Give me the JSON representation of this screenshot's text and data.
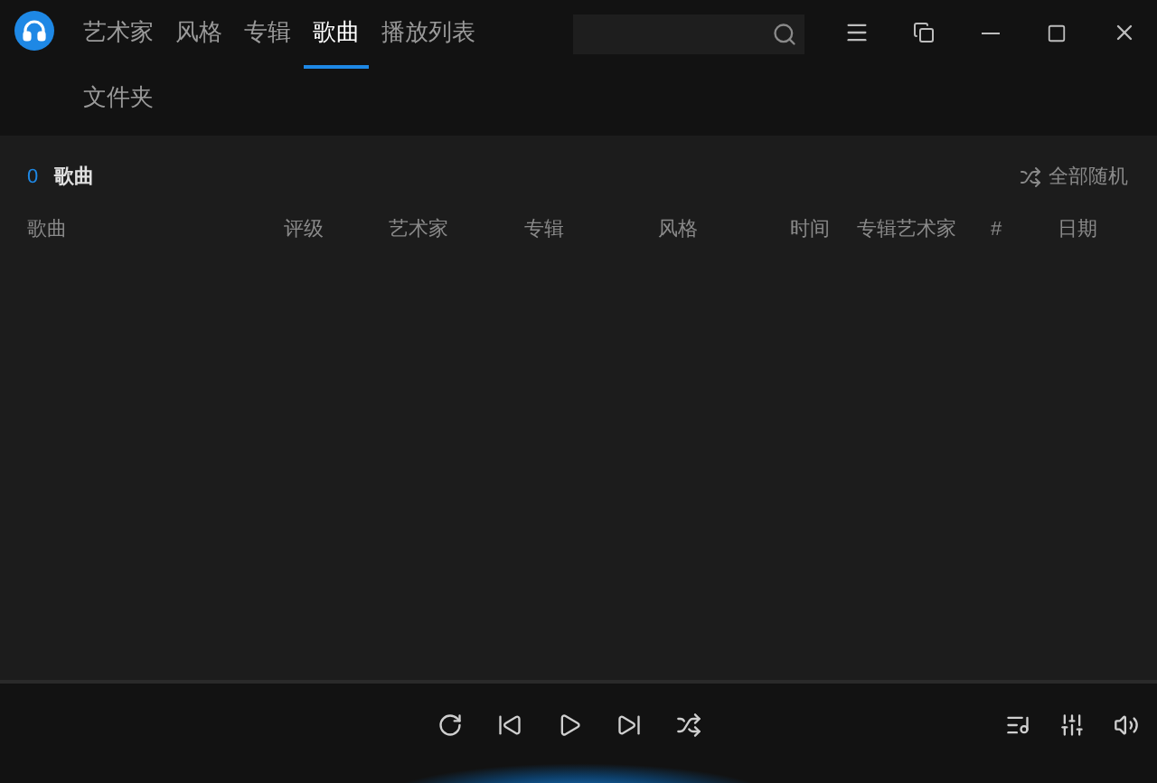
{
  "tabs": [
    {
      "label": "艺术家",
      "selected": false
    },
    {
      "label": "风格",
      "selected": false
    },
    {
      "label": "专辑",
      "selected": false
    },
    {
      "label": "歌曲",
      "selected": true
    },
    {
      "label": "播放列表",
      "selected": false
    }
  ],
  "tabs_row2": [
    {
      "label": "文件夹",
      "selected": false
    }
  ],
  "header": {
    "count": "0",
    "title": "歌曲",
    "shuffle_all": "全部随机"
  },
  "table": {
    "columns": [
      "歌曲",
      "评级",
      "艺术家",
      "专辑",
      "风格",
      "时间",
      "专辑艺术家",
      "#",
      "日期"
    ]
  }
}
